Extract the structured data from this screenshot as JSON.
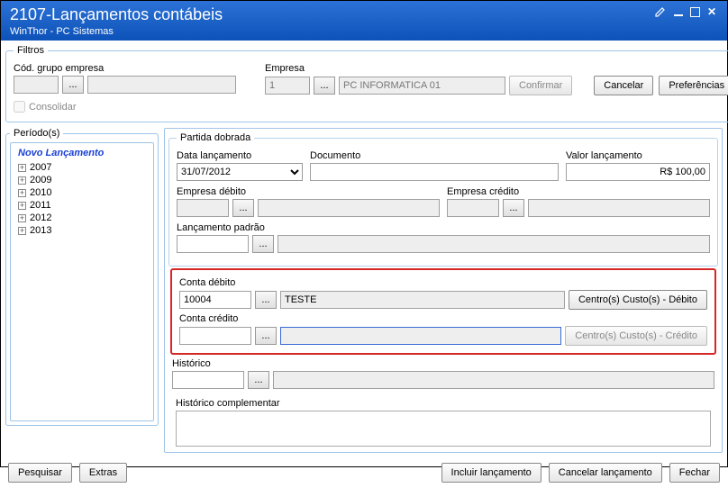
{
  "titlebar": {
    "title": "2107-Lançamentos contábeis",
    "subtitle": "WinThor - PC Sistemas"
  },
  "filtros": {
    "legend": "Filtros",
    "cod_grupo_label": "Cód. grupo empresa",
    "cod_grupo_val": "",
    "cod_grupo_desc": "",
    "empresa_label": "Empresa",
    "empresa_cod": "1",
    "empresa_desc": "PC INFORMATICA 01",
    "confirmar": "Confirmar",
    "cancelar": "Cancelar",
    "preferencias": "Preferências",
    "consolidar": "Consolidar"
  },
  "periodos": {
    "legend": "Período(s)",
    "novo": "Novo Lançamento",
    "anos": [
      "2007",
      "2009",
      "2010",
      "2011",
      "2012",
      "2013"
    ]
  },
  "partida": {
    "legend": "Partida dobrada",
    "data_label": "Data lançamento",
    "data_val": "31/07/2012",
    "documento_label": "Documento",
    "documento_val": "",
    "valor_label": "Valor lançamento",
    "valor_val": "R$ 100,00",
    "emp_deb_label": "Empresa débito",
    "emp_deb_val": "",
    "emp_cred_label": "Empresa crédito",
    "emp_cred_val": "",
    "lanc_padrao_label": "Lançamento padrão",
    "lanc_padrao_val": "",
    "conta_deb_label": "Conta débito",
    "conta_deb_cod": "10004",
    "conta_deb_desc": "TESTE",
    "cc_deb_btn": "Centro(s) Custo(s) - Débito",
    "conta_cred_label": "Conta crédito",
    "conta_cred_cod": "",
    "conta_cred_desc": "",
    "cc_cred_btn": "Centro(s) Custo(s) - Crédito",
    "historico_label": "Histórico",
    "historico_cod": "",
    "historico_desc": "",
    "historico_comp_label": "Histórico complementar",
    "historico_comp_val": ""
  },
  "footer": {
    "pesquisar": "Pesquisar",
    "extras": "Extras",
    "incluir": "Incluir lançamento",
    "cancelar": "Cancelar lançamento",
    "fechar": "Fechar"
  },
  "icons": {
    "ellipsis": "..."
  }
}
